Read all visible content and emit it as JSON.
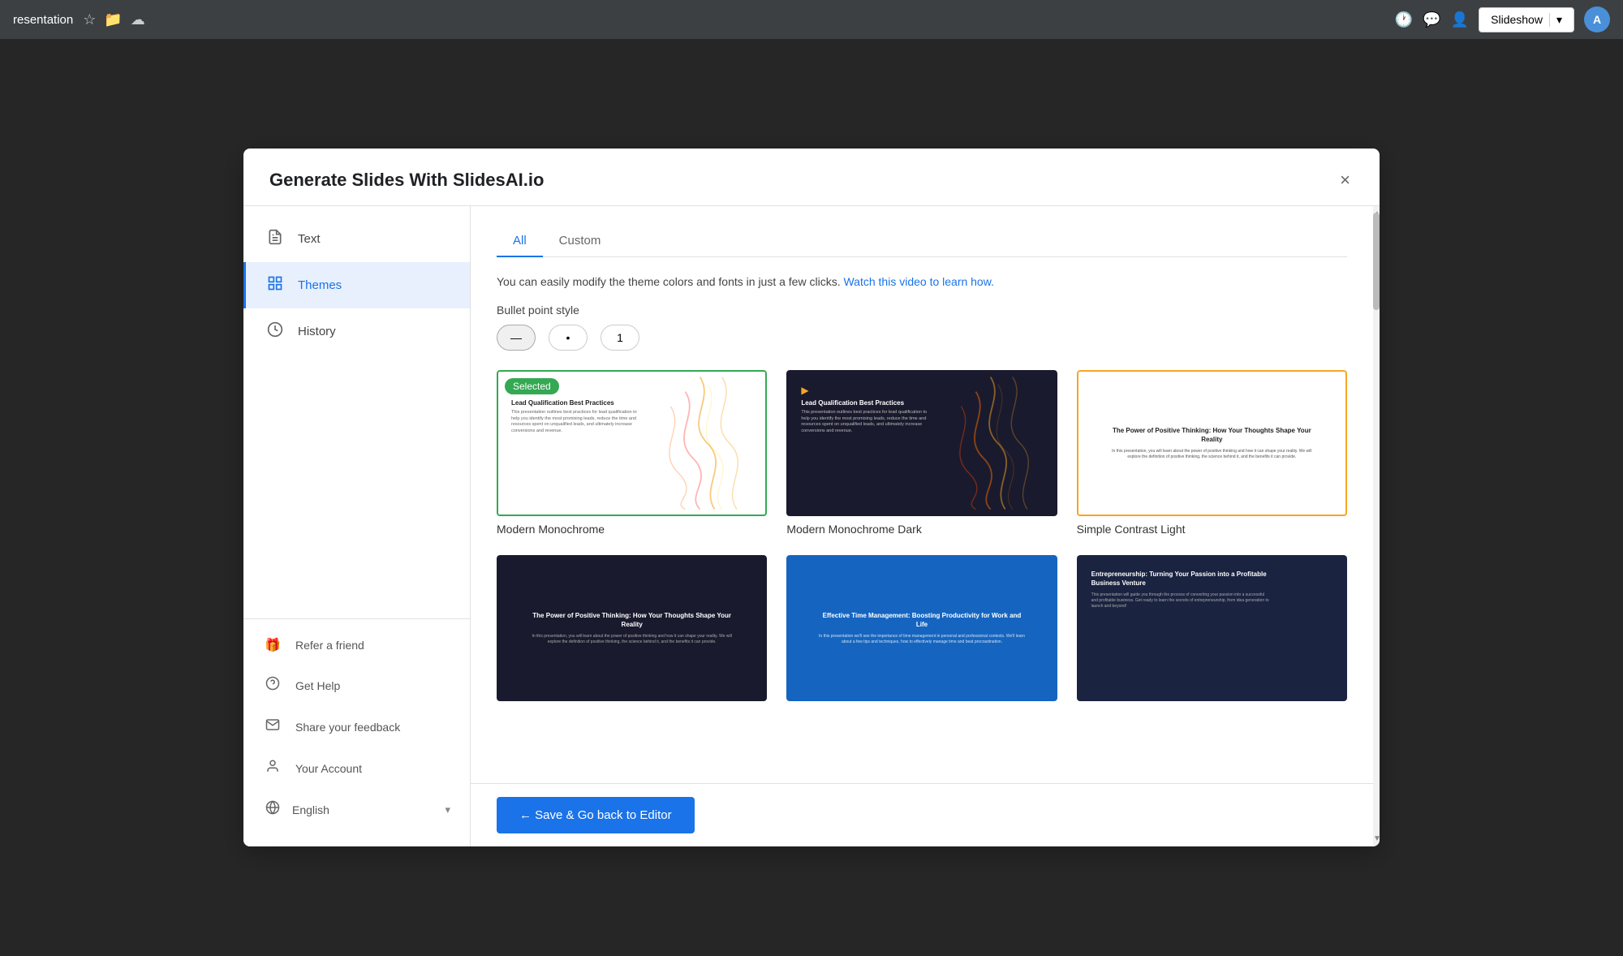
{
  "topbar": {
    "title": "resentation",
    "slideshow_label": "Slideshow",
    "avatar_letter": "A"
  },
  "modal": {
    "title": "Generate Slides With SlidesAI.io",
    "close_label": "×"
  },
  "sidebar": {
    "nav_items": [
      {
        "id": "text",
        "label": "Text",
        "icon": "📄"
      },
      {
        "id": "themes",
        "label": "Themes",
        "icon": "📊",
        "active": true
      },
      {
        "id": "history",
        "label": "History",
        "icon": "🕐"
      }
    ],
    "bottom_items": [
      {
        "id": "refer",
        "label": "Refer a friend",
        "icon": "🎁"
      },
      {
        "id": "help",
        "label": "Get Help",
        "icon": "❓"
      },
      {
        "id": "feedback",
        "label": "Share your feedback",
        "icon": "✉️"
      },
      {
        "id": "account",
        "label": "Your Account",
        "icon": "👤"
      }
    ],
    "language": {
      "label": "English",
      "icon": "🌐"
    }
  },
  "tabs": [
    {
      "id": "all",
      "label": "All",
      "active": true
    },
    {
      "id": "custom",
      "label": "Custom"
    }
  ],
  "info": {
    "text": "You can easily modify the theme colors and fonts in just a few clicks.",
    "link_text": "Watch this video to learn how."
  },
  "bullet_style": {
    "label": "Bullet point style",
    "options": [
      {
        "id": "dash",
        "symbol": "—",
        "active": true
      },
      {
        "id": "dot",
        "symbol": "•"
      },
      {
        "id": "number",
        "symbol": "1"
      }
    ]
  },
  "themes": [
    {
      "id": "modern-monochrome",
      "name": "Modern Monochrome",
      "selected": true,
      "border": "green",
      "style": "light-wave",
      "title": "Lead Qualification Best Practices",
      "subtitle": "This presentation outlines best practices for lead qualification to help you identify the most promising leads, reduce the time and resources spent on unqualified leads, and ultimately increase conversions and revenue.",
      "play_color": "#f5a623"
    },
    {
      "id": "modern-monochrome-dark",
      "name": "Modern Monochrome Dark",
      "selected": false,
      "border": "none",
      "style": "dark-wave",
      "title": "Lead Qualification Best Practices",
      "subtitle": "This presentation outlines best practices for lead qualification to help you identify the most promising leads, reduce the time and resources spent on unqualified leads, and ultimately increase conversions and revenue.",
      "play_color": "#f5a623"
    },
    {
      "id": "simple-contrast-light",
      "name": "Simple Contrast Light",
      "selected": false,
      "border": "orange",
      "style": "white-centered",
      "title": "The Power of Positive Thinking: How Your Thoughts Shape Your Reality",
      "subtitle": "In this presentation, you will learn about the power of positive thinking and how it can shape your reality. We will explore the definition of positive thinking, the science behind it, and the benefits it can provide."
    },
    {
      "id": "dark-power",
      "name": "",
      "selected": false,
      "border": "none",
      "style": "dark-centered",
      "title": "The Power of Positive Thinking: How Your Thoughts Shape Your Reality",
      "subtitle": "In this presentation, you will learn about the power of positive thinking and how it can shape your reality. We will explore the definition of positive thinking, the science behind it, and the benefits it can provide."
    },
    {
      "id": "blue-time",
      "name": "",
      "selected": false,
      "border": "none",
      "style": "blue-centered",
      "title": "Effective Time Management: Boosting Productivity for Work and Life",
      "subtitle": "In this presentation we'll see the importance of time management in personal and professional contexts. We'll learn about a few tips and techniques, how to effectively manage time and beat procrastination."
    },
    {
      "id": "navy-entre",
      "name": "",
      "selected": false,
      "border": "none",
      "style": "navy-left",
      "title": "Entrepreneurship: Turning Your Passion into a Profitable Business Venture",
      "subtitle": "This presentation will guide you through the process of converting your passion into a successful and profitable business. Get ready to learn the secrets of entrepreneurship, from idea generation to launch and beyond!"
    }
  ],
  "save_button": {
    "label": "← Save & Go back to Editor"
  }
}
